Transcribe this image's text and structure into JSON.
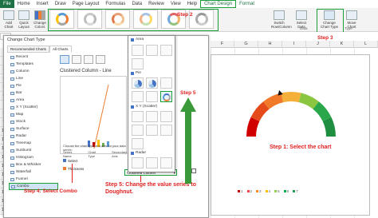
{
  "ribbon": {
    "tabs": [
      {
        "label": "File",
        "kind": "file"
      },
      {
        "label": "Home",
        "kind": ""
      },
      {
        "label": "Insert",
        "kind": ""
      },
      {
        "label": "Draw",
        "kind": ""
      },
      {
        "label": "Page Layout",
        "kind": ""
      },
      {
        "label": "Formulas",
        "kind": ""
      },
      {
        "label": "Data",
        "kind": ""
      },
      {
        "label": "Review",
        "kind": ""
      },
      {
        "label": "View",
        "kind": ""
      },
      {
        "label": "Help",
        "kind": ""
      },
      {
        "label": "Chart Design",
        "kind": "active"
      },
      {
        "label": "Format",
        "kind": "fmt"
      }
    ],
    "left_buttons": {
      "add_chart": "Add Chart",
      "quick_layout": "Quick Layout",
      "change_colors": "Change Colors"
    },
    "right_buttons": {
      "switch_row": "Switch Row/Column",
      "select_data": "Select Data",
      "change_chart_type": "Change Chart Type",
      "move_chart": "Move Chart"
    },
    "group_labels": {
      "data": "Data",
      "type": "Type"
    }
  },
  "sheet": {
    "columns": [
      "F",
      "G",
      "H",
      "I",
      "J",
      "K",
      "L"
    ],
    "rows": [
      "1",
      "2",
      "3",
      "4",
      "5",
      "6",
      "7",
      "8",
      "9",
      "10",
      "11",
      "12",
      "13",
      "14",
      "15",
      "16",
      "17",
      "18",
      "19",
      "20"
    ],
    "cell_fragments": [
      "Fi",
      "Po",
      "Po",
      "Go",
      "Sk",
      "Ve",
      "Ex",
      "Le",
      "Ch",
      "B",
      "B",
      "Pr",
      "B"
    ]
  },
  "dialog": {
    "title": "Change Chart Type",
    "tabs": [
      "Recommended Charts",
      "All Charts"
    ],
    "items": [
      {
        "label": "Recent",
        "selected": false
      },
      {
        "label": "Templates",
        "selected": false
      },
      {
        "label": "Column",
        "selected": false
      },
      {
        "label": "Line",
        "selected": false
      },
      {
        "label": "Pie",
        "selected": false
      },
      {
        "label": "Bar",
        "selected": false
      },
      {
        "label": "Area",
        "selected": false
      },
      {
        "label": "X Y (Scatter)",
        "selected": false
      },
      {
        "label": "Map",
        "selected": false
      },
      {
        "label": "Stock",
        "selected": false
      },
      {
        "label": "Surface",
        "selected": false
      },
      {
        "label": "Radar",
        "selected": false
      },
      {
        "label": "Treemap",
        "selected": false
      },
      {
        "label": "Sunburst",
        "selected": false
      },
      {
        "label": "Histogram",
        "selected": false
      },
      {
        "label": "Box & Whisker",
        "selected": false
      },
      {
        "label": "Waterfall",
        "selected": false
      },
      {
        "label": "Funnel",
        "selected": false
      },
      {
        "label": "Combo",
        "selected": true
      }
    ],
    "preview_title": "Clustered Column - Line",
    "series_instruction": "Choose the chart type and axis for your data series:",
    "series_headers": {
      "name": "Series Name",
      "type": "Chart Type",
      "axis": "Secondary Axis"
    },
    "series": [
      {
        "name": "Select",
        "type": "Clustered Column",
        "highlighted": true
      },
      {
        "name": "Thickness",
        "type": "",
        "highlighted": false
      }
    ]
  },
  "flyout": {
    "categories": [
      "Area",
      "Pie",
      "X Y (Scatter)",
      "Radar"
    ]
  },
  "chart": {
    "legend": [
      {
        "label": "1",
        "color": "#c00000"
      },
      {
        "label": "2",
        "color": "#ff4040"
      },
      {
        "label": "3",
        "color": "#ff8c1a"
      },
      {
        "label": "4",
        "color": "#ffc000"
      },
      {
        "label": "5",
        "color": "#92d050"
      },
      {
        "label": "6",
        "color": "#00b050"
      },
      {
        "label": "7",
        "color": "#1e9e55"
      }
    ],
    "colors": [
      "#d00000",
      "#e54a1a",
      "#f07a2a",
      "#f5b03a",
      "#8ac640",
      "#2aa74a",
      "#1e8f40"
    ]
  },
  "annotations": {
    "step1": "Step 1: Select the chart",
    "step2": "Step 2",
    "step3": "Step 3",
    "step4": "Step 4: Select Combo",
    "step5": "Step 5",
    "step5_line1": "Step 5: Change the value series to",
    "step5_line2": "Doughnut."
  }
}
